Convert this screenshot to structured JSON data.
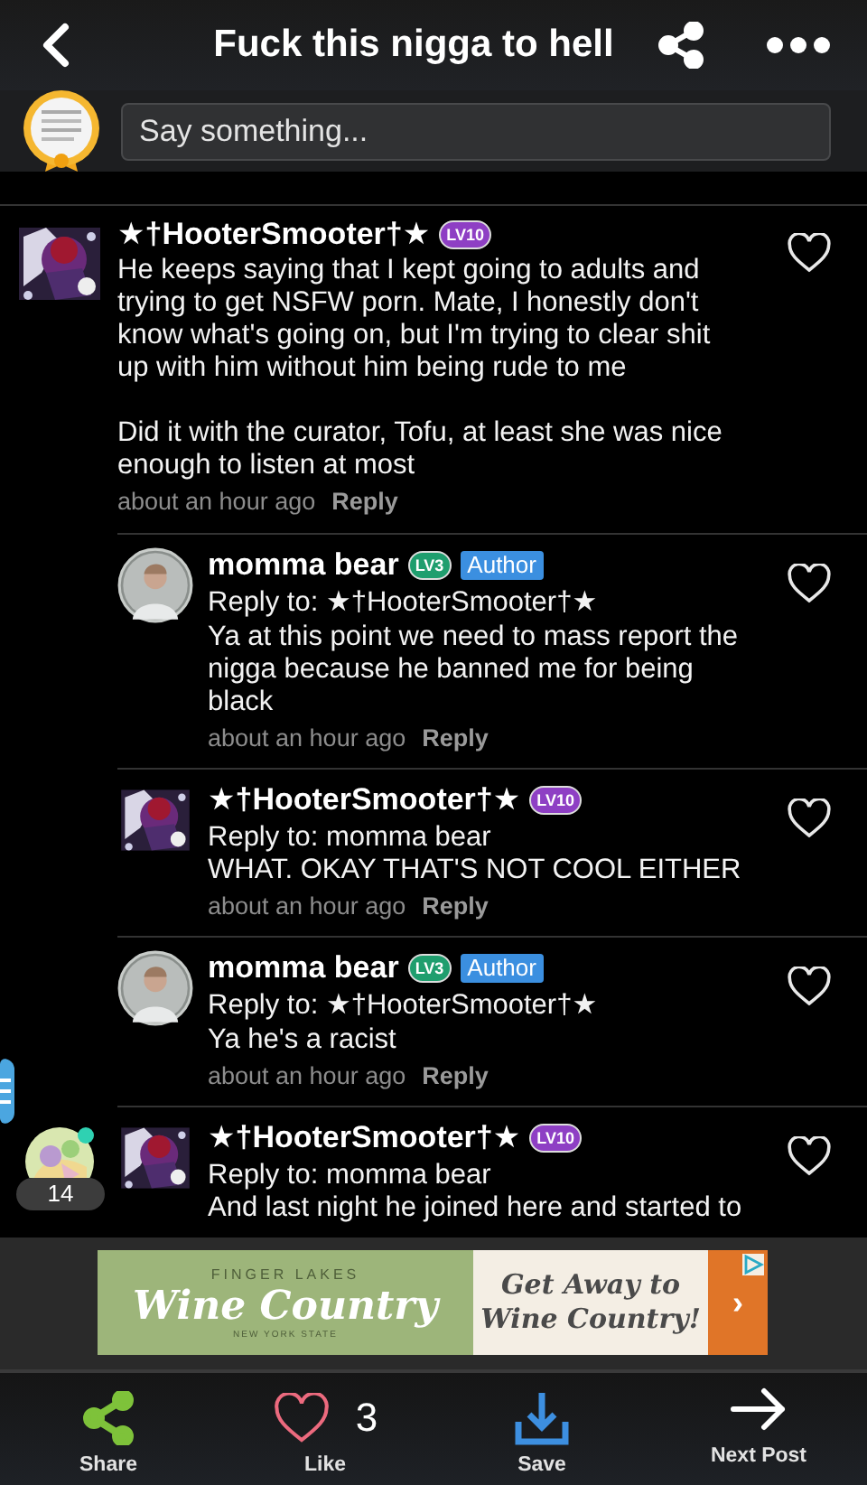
{
  "header": {
    "title": "Fuck this nigga to hell"
  },
  "composer": {
    "placeholder": "Say something..."
  },
  "comments": [
    {
      "kind": "top",
      "avatar": {
        "kind": "square"
      },
      "author": "★†HooterSmooter†★",
      "level": {
        "label": "LV10",
        "color": "#8e3fc4"
      },
      "body": "He keeps saying that I kept going to adults and trying to get NSFW porn. Mate, I honestly don't know what's going on, but I'm trying to clear shit up with him without him being rude to me\n\nDid it with the curator, Tofu, at least she was nice enough to listen at most",
      "time": "about an hour ago",
      "action": "Reply"
    },
    {
      "kind": "reply",
      "avatar": {
        "kind": "round"
      },
      "author": "momma bear",
      "level": {
        "label": "LV3",
        "color": "#1f9e6e"
      },
      "tag": "Author",
      "reply_to": "Reply to: ★†HooterSmooter†★",
      "body": "Ya at this point we need to mass report the nigga because he banned me for being black",
      "time": "about an hour ago",
      "action": "Reply"
    },
    {
      "kind": "reply",
      "avatar": {
        "kind": "square"
      },
      "author": "★†HooterSmooter†★",
      "level": {
        "label": "LV10",
        "color": "#8e3fc4"
      },
      "reply_to": "Reply to: momma bear",
      "body": "WHAT. OKAY THAT'S NOT COOL EITHER",
      "time": "about an hour ago",
      "action": "Reply"
    },
    {
      "kind": "reply",
      "avatar": {
        "kind": "round"
      },
      "author": "momma bear",
      "level": {
        "label": "LV3",
        "color": "#1f9e6e"
      },
      "tag": "Author",
      "reply_to": "Reply to: ★†HooterSmooter†★",
      "body": "Ya he's a racist",
      "time": "about an hour ago",
      "action": "Reply"
    },
    {
      "kind": "reply",
      "avatar": {
        "kind": "square"
      },
      "author": "★†HooterSmooter†★",
      "level": {
        "label": "LV10",
        "color": "#8e3fc4"
      },
      "reply_to": "Reply to: momma bear",
      "body": "And last night he joined here and started to"
    }
  ],
  "floating": {
    "count": "14",
    "online": true
  },
  "ad": {
    "eyebrow": "FINGER LAKES",
    "brand": "Wine Country",
    "region": "NEW YORK STATE",
    "headline": "Get Away to\nWine Country!",
    "cta": "›"
  },
  "bottom_bar": [
    {
      "kind": "share",
      "label": "Share"
    },
    {
      "kind": "like",
      "label": "Like",
      "count": "3"
    },
    {
      "kind": "save",
      "label": "Save"
    },
    {
      "kind": "next",
      "label": "Next Post"
    }
  ]
}
